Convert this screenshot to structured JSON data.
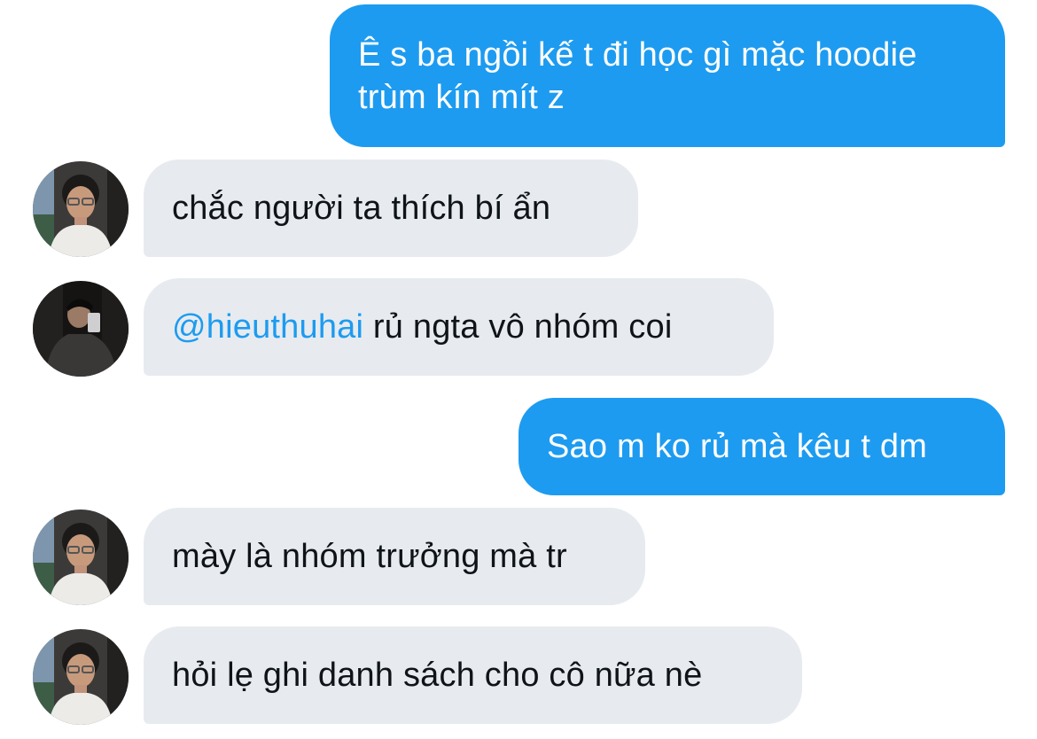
{
  "conversation": {
    "messages": [
      {
        "direction": "outgoing",
        "text": "Ê s ba ngồi kế t đi học gì mặc hoodie trùm kín mít z"
      },
      {
        "direction": "incoming",
        "avatar": "person-avatar-sunglasses-icon",
        "text": "chắc người ta thích bí ẩn"
      },
      {
        "direction": "incoming",
        "avatar": "person-avatar-mirror-selfie-icon",
        "mention": "@hieuthuhai",
        "text": " rủ ngta vô nhóm coi"
      },
      {
        "direction": "outgoing",
        "text": "Sao m ko rủ mà kêu t dm"
      },
      {
        "direction": "incoming",
        "avatar": "person-avatar-sunglasses-icon",
        "text": "mày là nhóm trưởng mà tr"
      },
      {
        "direction": "incoming",
        "avatar": "person-avatar-sunglasses-icon",
        "text": "hỏi lẹ ghi danh sách cho cô nữa nè"
      }
    ]
  },
  "colors": {
    "outgoing_bubble": "#1d9bf0",
    "incoming_bubble": "#e7ebef",
    "mention": "#1d9bf0",
    "text_dark": "#0f1419"
  }
}
